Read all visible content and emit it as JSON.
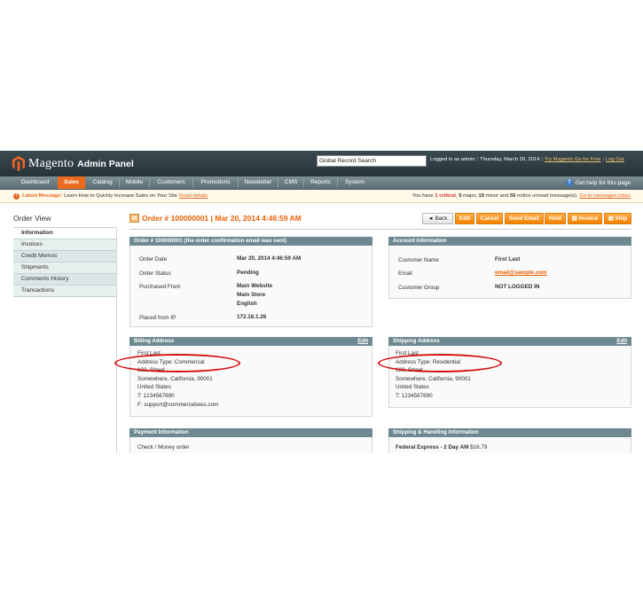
{
  "header": {
    "logo_word": "Magento",
    "logo_sub": "Admin Panel",
    "search_value": "Global Record Search",
    "logged_in": "Logged in as admin",
    "date": "Thursday, March 20, 2014",
    "try_go": "Try Magento Go for Free",
    "logout": "Log Out"
  },
  "nav": {
    "items": [
      "Dashboard",
      "Sales",
      "Catalog",
      "Mobile",
      "Customers",
      "Promotions",
      "Newsletter",
      "CMS",
      "Reports",
      "System"
    ],
    "active": "Sales",
    "help": "Get help for this page"
  },
  "message": {
    "label": "Latest Message:",
    "text": "Learn How to Quickly Increase Sales on Your Site",
    "link": "Read details",
    "right_pre": "You have",
    "critical_count": "1",
    "critical": "critical",
    "major_count": "5",
    "major": "major,",
    "minor_count": "19",
    "minor": "minor and",
    "notice_count": "56",
    "notice": "notice unread message(s).",
    "right_link": "Go to messages inbox"
  },
  "sidebar": {
    "title": "Order View",
    "items": [
      "Information",
      "Invoices",
      "Credit Memos",
      "Shipments",
      "Comments History",
      "Transactions"
    ]
  },
  "page": {
    "title": "Order # 100000001 | Mar 20, 2014 4:46:59 AM",
    "buttons": {
      "back": "Back",
      "edit": "Edit",
      "cancel": "Cancel",
      "send_email": "Send Email",
      "hold": "Hold",
      "invoice": "Invoice",
      "ship": "Ship"
    }
  },
  "order_box": {
    "head": "Order # 100000001 (the order confirmation email was sent)",
    "date_label": "Order Date",
    "date_value": "Mar 20, 2014 4:46:59 AM",
    "status_label": "Order Status",
    "status_value": "Pending",
    "from_label": "Purchased From",
    "from_1": "Main Website",
    "from_2": "Main Store",
    "from_3": "English",
    "ip_label": "Placed from IP",
    "ip_value": "172.16.1.26"
  },
  "account_box": {
    "head": "Account Information",
    "name_label": "Customer Name",
    "name_value": "First Last",
    "email_label": "Email",
    "email_value": "email@sample.com",
    "group_label": "Customer Group",
    "group_value": "NOT LOGGED IN"
  },
  "billing": {
    "head": "Billing Address",
    "edit": "Edit",
    "lines": [
      "First Last",
      "Address Type: Commercial",
      "123, Street",
      "Somewhere, California, 90001",
      "United States",
      "T: 1234567890",
      "F: support@commercebees.com"
    ]
  },
  "shipping": {
    "head": "Shipping Address",
    "edit": "Edit",
    "lines": [
      "First Last",
      "Address Type: Residential",
      "123, Street",
      "Somewhere, California, 90001",
      "United States",
      "T: 1234567890"
    ]
  },
  "payment": {
    "head": "Payment Information",
    "method": "Check / Money order"
  },
  "shipping_handling": {
    "head": "Shipping & Handling Information",
    "method": "Federal Express - 2 Day AM",
    "price": "$16.79"
  },
  "colors": {
    "accent": "#eb5e00",
    "nav_active": "#eb6a1e",
    "header_bg": "#2f3d42",
    "box_head": "#6f8992",
    "highlight": "#d40f0f"
  }
}
